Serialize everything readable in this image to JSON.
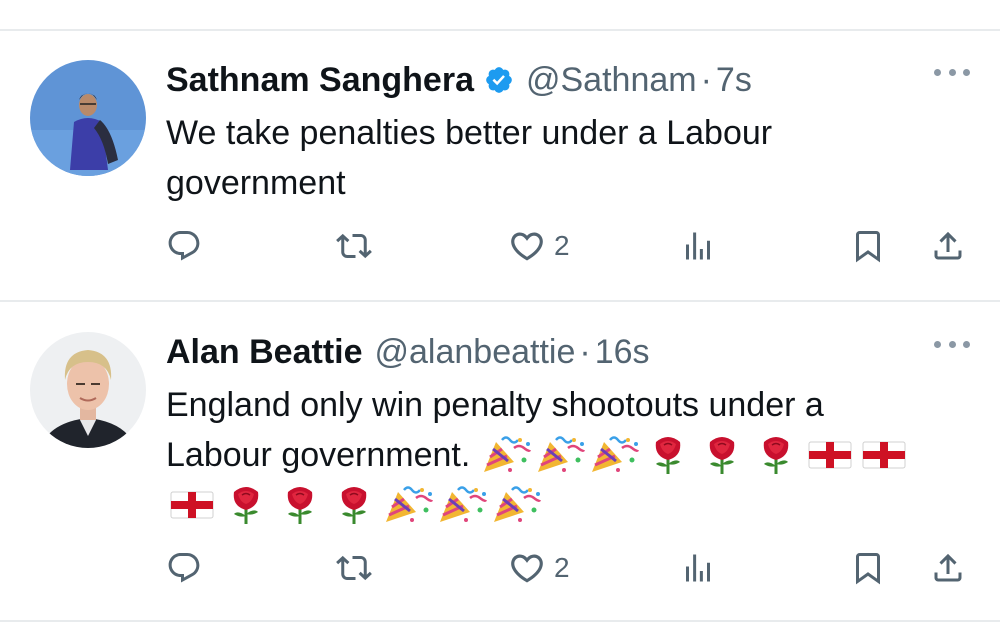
{
  "colors": {
    "text": "#0f1419",
    "muted": "#536471",
    "verified": "#1d9bf0",
    "divider": "#e8ebed"
  },
  "tweets": [
    {
      "name": "Sathnam Sanghera",
      "verified": true,
      "handle": "@Sathnam",
      "dot": "·",
      "time": "7s",
      "text_lines": [
        "We take penalties better under a Labour",
        "government"
      ],
      "emoji_rows": [],
      "actions": {
        "reply": "",
        "retweet": "",
        "like": "2",
        "views": ""
      }
    },
    {
      "name": "Alan Beattie",
      "verified": false,
      "handle": "@alanbeattie",
      "dot": "·",
      "time": "16s",
      "text_lines": [
        "England only win penalty shootouts under a",
        "Labour government."
      ],
      "emoji_rows": [
        [
          "party-popper-icon",
          "party-popper-icon",
          "party-popper-icon",
          "rose-icon",
          "rose-icon",
          "rose-icon",
          "england-flag-icon",
          "england-flag-icon"
        ],
        [
          "england-flag-icon",
          "rose-icon",
          "rose-icon",
          "rose-icon",
          "party-popper-icon",
          "party-popper-icon",
          "party-popper-icon"
        ]
      ],
      "actions": {
        "reply": "",
        "retweet": "",
        "like": "2",
        "views": ""
      }
    }
  ]
}
